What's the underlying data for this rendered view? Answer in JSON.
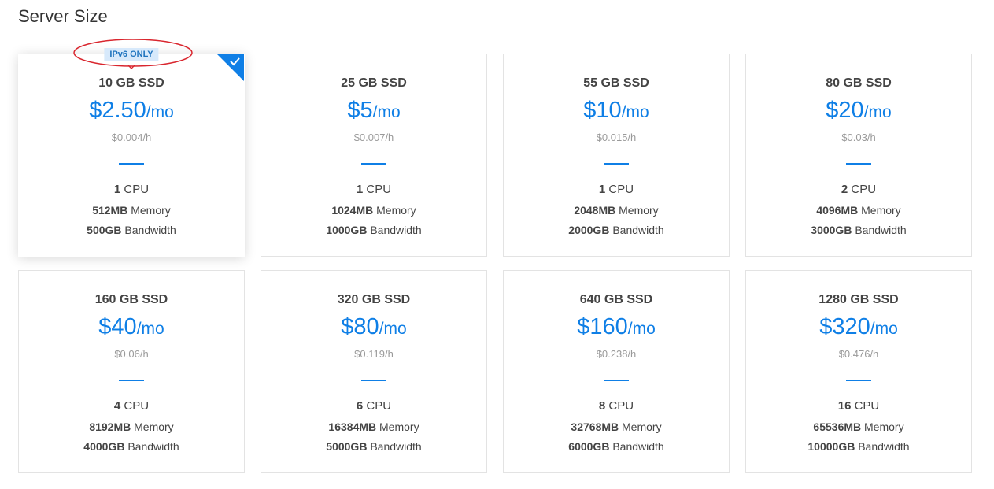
{
  "section_title": "Server Size",
  "selected_badge": "IPv6 ONLY",
  "colors": {
    "accent": "#0f7fe6",
    "badge_bg": "#d7e9fb",
    "annotation": "#d9262e"
  },
  "plans": [
    {
      "ssd": "10 GB SSD",
      "price": "$2.50",
      "unit": "/mo",
      "hourly": "$0.004/h",
      "cpu": "1",
      "cpu_label": "CPU",
      "memory": "512MB",
      "memory_label": "Memory",
      "bandwidth": "500GB",
      "bandwidth_label": "Bandwidth",
      "selected": true
    },
    {
      "ssd": "25 GB SSD",
      "price": "$5",
      "unit": "/mo",
      "hourly": "$0.007/h",
      "cpu": "1",
      "cpu_label": "CPU",
      "memory": "1024MB",
      "memory_label": "Memory",
      "bandwidth": "1000GB",
      "bandwidth_label": "Bandwidth",
      "selected": false
    },
    {
      "ssd": "55 GB SSD",
      "price": "$10",
      "unit": "/mo",
      "hourly": "$0.015/h",
      "cpu": "1",
      "cpu_label": "CPU",
      "memory": "2048MB",
      "memory_label": "Memory",
      "bandwidth": "2000GB",
      "bandwidth_label": "Bandwidth",
      "selected": false
    },
    {
      "ssd": "80 GB SSD",
      "price": "$20",
      "unit": "/mo",
      "hourly": "$0.03/h",
      "cpu": "2",
      "cpu_label": "CPU",
      "memory": "4096MB",
      "memory_label": "Memory",
      "bandwidth": "3000GB",
      "bandwidth_label": "Bandwidth",
      "selected": false
    },
    {
      "ssd": "160 GB SSD",
      "price": "$40",
      "unit": "/mo",
      "hourly": "$0.06/h",
      "cpu": "4",
      "cpu_label": "CPU",
      "memory": "8192MB",
      "memory_label": "Memory",
      "bandwidth": "4000GB",
      "bandwidth_label": "Bandwidth",
      "selected": false
    },
    {
      "ssd": "320 GB SSD",
      "price": "$80",
      "unit": "/mo",
      "hourly": "$0.119/h",
      "cpu": "6",
      "cpu_label": "CPU",
      "memory": "16384MB",
      "memory_label": "Memory",
      "bandwidth": "5000GB",
      "bandwidth_label": "Bandwidth",
      "selected": false
    },
    {
      "ssd": "640 GB SSD",
      "price": "$160",
      "unit": "/mo",
      "hourly": "$0.238/h",
      "cpu": "8",
      "cpu_label": "CPU",
      "memory": "32768MB",
      "memory_label": "Memory",
      "bandwidth": "6000GB",
      "bandwidth_label": "Bandwidth",
      "selected": false
    },
    {
      "ssd": "1280 GB SSD",
      "price": "$320",
      "unit": "/mo",
      "hourly": "$0.476/h",
      "cpu": "16",
      "cpu_label": "CPU",
      "memory": "65536MB",
      "memory_label": "Memory",
      "bandwidth": "10000GB",
      "bandwidth_label": "Bandwidth",
      "selected": false
    }
  ]
}
